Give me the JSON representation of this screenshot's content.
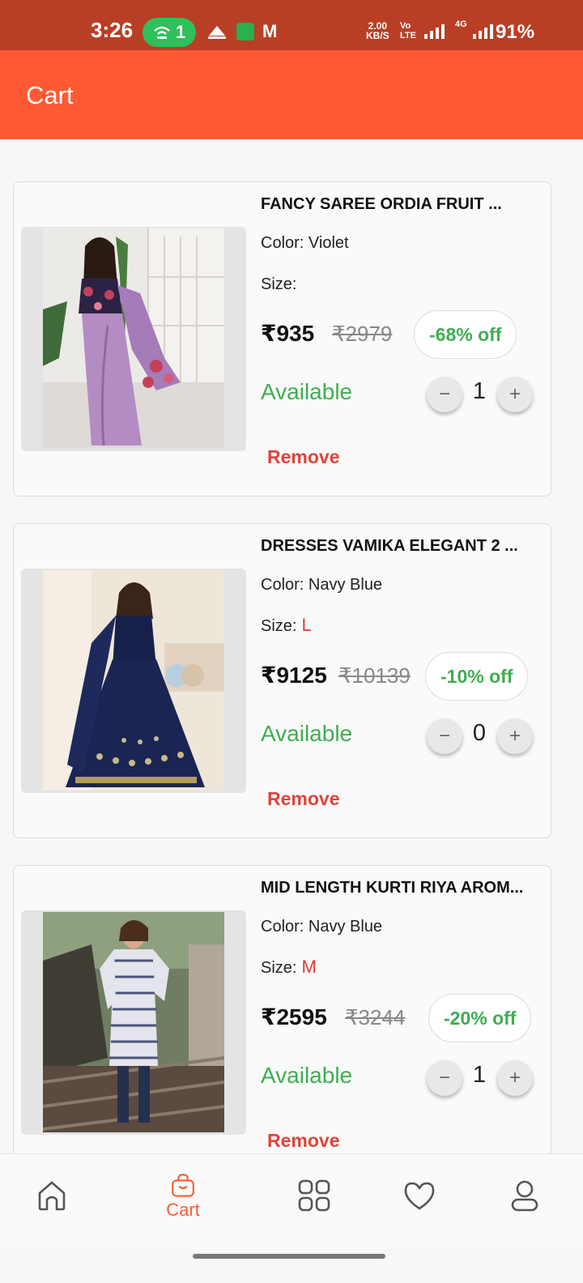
{
  "status_bar": {
    "time": "3:26",
    "hotspot_count": "1",
    "speed_value": "2.00",
    "speed_unit": "KB/S",
    "volte": "Vo LTE",
    "net_type": "4G",
    "battery": "91%"
  },
  "app_bar": {
    "title": "Cart"
  },
  "cart": {
    "items": [
      {
        "title": "FANCY SAREE ORDIA FRUIT ...",
        "color_label": "Color: Violet",
        "size_label": "Size:",
        "size_value": "",
        "price": "₹935",
        "mrp": "₹2979",
        "discount": "-68% off",
        "availability": "Available",
        "quantity": "1",
        "minus": "−",
        "plus": "+",
        "remove_label": "Remove"
      },
      {
        "title": "DRESSES VAMIKA ELEGANT 2 ...",
        "color_label": "Color: Navy Blue",
        "size_label": "Size:",
        "size_value": "L",
        "price": "₹9125",
        "mrp": "₹10139",
        "discount": "-10% off",
        "availability": "Available",
        "quantity": "0",
        "minus": "−",
        "plus": "+",
        "remove_label": "Remove"
      },
      {
        "title": "MID LENGTH KURTI RIYA AROM...",
        "color_label": "Color: Navy Blue",
        "size_label": "Size:",
        "size_value": "M",
        "price": "₹2595",
        "mrp": "₹3244",
        "discount": "-20% off",
        "availability": "Available",
        "quantity": "1",
        "minus": "−",
        "plus": "+",
        "remove_label": "Remove"
      }
    ]
  },
  "bottom_nav": {
    "items": [
      {
        "icon": "home-icon",
        "label": ""
      },
      {
        "icon": "shopping-bag-icon",
        "label": "Cart",
        "active": true
      },
      {
        "icon": "grid-icon",
        "label": ""
      },
      {
        "icon": "heart-icon",
        "label": ""
      },
      {
        "icon": "user-icon",
        "label": ""
      }
    ]
  },
  "colors": {
    "status_bar": "#b83f25",
    "app_bar": "#ff5a33",
    "accent": "#ff5a33",
    "discount_green": "#3fae50",
    "remove_red": "#e0443a"
  }
}
